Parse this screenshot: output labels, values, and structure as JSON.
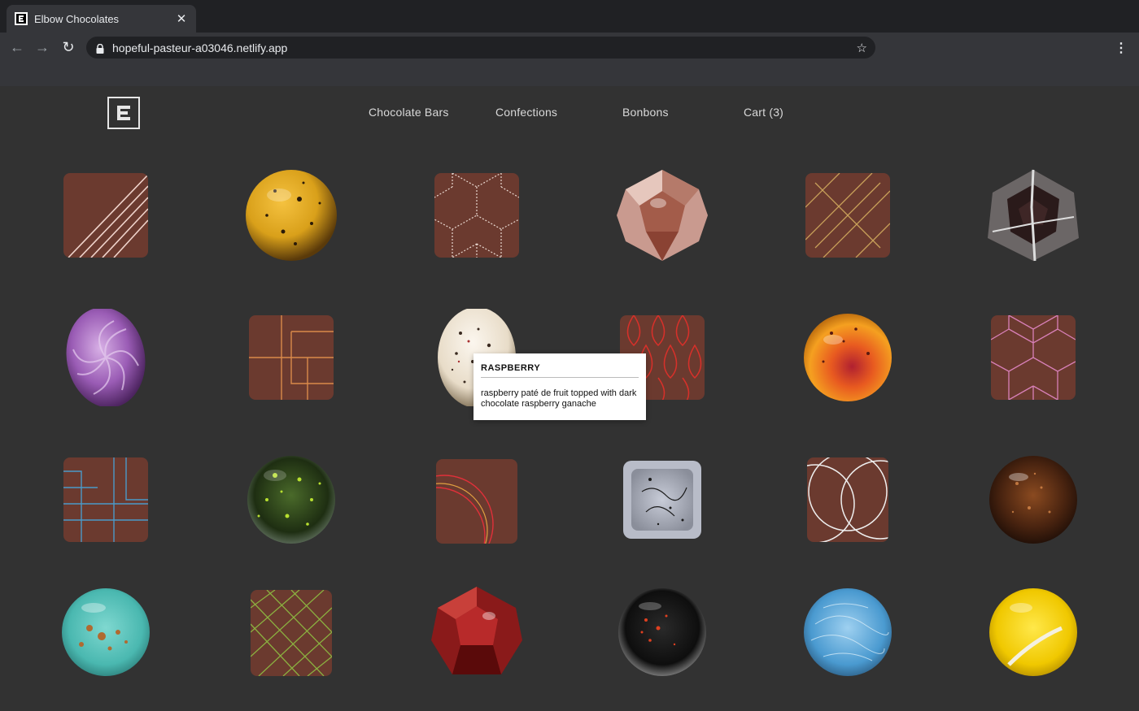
{
  "browser": {
    "tab_title": "Elbow Chocolates",
    "url": "hopeful-pasteur-a03046.netlify.app",
    "icons": [
      "back-icon",
      "forward-icon",
      "reload-icon",
      "lock-icon",
      "star-icon",
      "menu-icon",
      "close-icon"
    ]
  },
  "nav": {
    "links": [
      "Chocolate Bars",
      "Confections",
      "Bonbons",
      "Cart (3)"
    ]
  },
  "tooltip": {
    "title": "RASPBERRY",
    "description": "raspberry paté de fruit topped with dark chocolate raspberry ganache"
  },
  "colors": {
    "page_bg": "#323232",
    "chocolate": "#6b3a2f",
    "chrome_dark": "#202124",
    "chrome_tab": "#35363a"
  }
}
